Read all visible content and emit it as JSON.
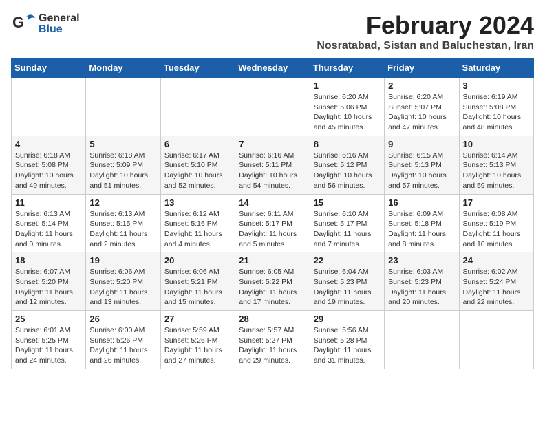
{
  "header": {
    "logo_general": "General",
    "logo_blue": "Blue",
    "title": "February 2024",
    "subtitle": "Nosratabad, Sistan and Baluchestan, Iran"
  },
  "days_of_week": [
    "Sunday",
    "Monday",
    "Tuesday",
    "Wednesday",
    "Thursday",
    "Friday",
    "Saturday"
  ],
  "weeks": [
    [
      {
        "day": "",
        "info": ""
      },
      {
        "day": "",
        "info": ""
      },
      {
        "day": "",
        "info": ""
      },
      {
        "day": "",
        "info": ""
      },
      {
        "day": "1",
        "info": "Sunrise: 6:20 AM\nSunset: 5:06 PM\nDaylight: 10 hours\nand 45 minutes."
      },
      {
        "day": "2",
        "info": "Sunrise: 6:20 AM\nSunset: 5:07 PM\nDaylight: 10 hours\nand 47 minutes."
      },
      {
        "day": "3",
        "info": "Sunrise: 6:19 AM\nSunset: 5:08 PM\nDaylight: 10 hours\nand 48 minutes."
      }
    ],
    [
      {
        "day": "4",
        "info": "Sunrise: 6:18 AM\nSunset: 5:08 PM\nDaylight: 10 hours\nand 49 minutes."
      },
      {
        "day": "5",
        "info": "Sunrise: 6:18 AM\nSunset: 5:09 PM\nDaylight: 10 hours\nand 51 minutes."
      },
      {
        "day": "6",
        "info": "Sunrise: 6:17 AM\nSunset: 5:10 PM\nDaylight: 10 hours\nand 52 minutes."
      },
      {
        "day": "7",
        "info": "Sunrise: 6:16 AM\nSunset: 5:11 PM\nDaylight: 10 hours\nand 54 minutes."
      },
      {
        "day": "8",
        "info": "Sunrise: 6:16 AM\nSunset: 5:12 PM\nDaylight: 10 hours\nand 56 minutes."
      },
      {
        "day": "9",
        "info": "Sunrise: 6:15 AM\nSunset: 5:13 PM\nDaylight: 10 hours\nand 57 minutes."
      },
      {
        "day": "10",
        "info": "Sunrise: 6:14 AM\nSunset: 5:13 PM\nDaylight: 10 hours\nand 59 minutes."
      }
    ],
    [
      {
        "day": "11",
        "info": "Sunrise: 6:13 AM\nSunset: 5:14 PM\nDaylight: 11 hours\nand 0 minutes."
      },
      {
        "day": "12",
        "info": "Sunrise: 6:13 AM\nSunset: 5:15 PM\nDaylight: 11 hours\nand 2 minutes."
      },
      {
        "day": "13",
        "info": "Sunrise: 6:12 AM\nSunset: 5:16 PM\nDaylight: 11 hours\nand 4 minutes."
      },
      {
        "day": "14",
        "info": "Sunrise: 6:11 AM\nSunset: 5:17 PM\nDaylight: 11 hours\nand 5 minutes."
      },
      {
        "day": "15",
        "info": "Sunrise: 6:10 AM\nSunset: 5:17 PM\nDaylight: 11 hours\nand 7 minutes."
      },
      {
        "day": "16",
        "info": "Sunrise: 6:09 AM\nSunset: 5:18 PM\nDaylight: 11 hours\nand 8 minutes."
      },
      {
        "day": "17",
        "info": "Sunrise: 6:08 AM\nSunset: 5:19 PM\nDaylight: 11 hours\nand 10 minutes."
      }
    ],
    [
      {
        "day": "18",
        "info": "Sunrise: 6:07 AM\nSunset: 5:20 PM\nDaylight: 11 hours\nand 12 minutes."
      },
      {
        "day": "19",
        "info": "Sunrise: 6:06 AM\nSunset: 5:20 PM\nDaylight: 11 hours\nand 13 minutes."
      },
      {
        "day": "20",
        "info": "Sunrise: 6:06 AM\nSunset: 5:21 PM\nDaylight: 11 hours\nand 15 minutes."
      },
      {
        "day": "21",
        "info": "Sunrise: 6:05 AM\nSunset: 5:22 PM\nDaylight: 11 hours\nand 17 minutes."
      },
      {
        "day": "22",
        "info": "Sunrise: 6:04 AM\nSunset: 5:23 PM\nDaylight: 11 hours\nand 19 minutes."
      },
      {
        "day": "23",
        "info": "Sunrise: 6:03 AM\nSunset: 5:23 PM\nDaylight: 11 hours\nand 20 minutes."
      },
      {
        "day": "24",
        "info": "Sunrise: 6:02 AM\nSunset: 5:24 PM\nDaylight: 11 hours\nand 22 minutes."
      }
    ],
    [
      {
        "day": "25",
        "info": "Sunrise: 6:01 AM\nSunset: 5:25 PM\nDaylight: 11 hours\nand 24 minutes."
      },
      {
        "day": "26",
        "info": "Sunrise: 6:00 AM\nSunset: 5:26 PM\nDaylight: 11 hours\nand 26 minutes."
      },
      {
        "day": "27",
        "info": "Sunrise: 5:59 AM\nSunset: 5:26 PM\nDaylight: 11 hours\nand 27 minutes."
      },
      {
        "day": "28",
        "info": "Sunrise: 5:57 AM\nSunset: 5:27 PM\nDaylight: 11 hours\nand 29 minutes."
      },
      {
        "day": "29",
        "info": "Sunrise: 5:56 AM\nSunset: 5:28 PM\nDaylight: 11 hours\nand 31 minutes."
      },
      {
        "day": "",
        "info": ""
      },
      {
        "day": "",
        "info": ""
      }
    ]
  ]
}
